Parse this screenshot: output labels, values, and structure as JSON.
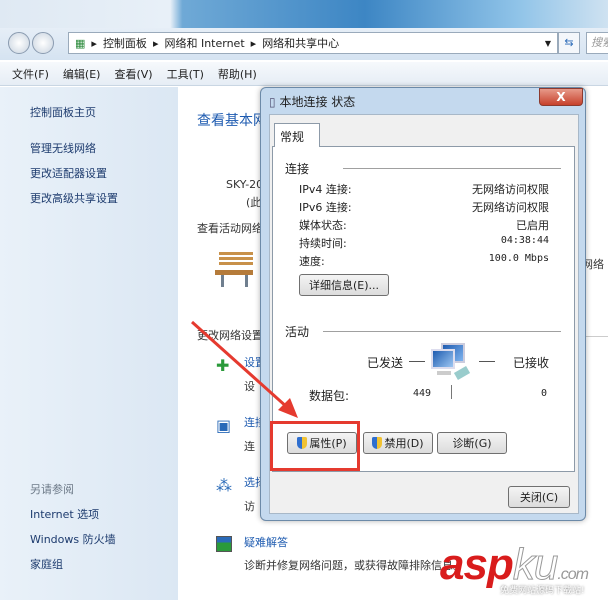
{
  "address": {
    "crumbs": [
      "控制面板",
      "网络和 Internet",
      "网络和共享中心"
    ],
    "search_placeholder": "搜索"
  },
  "menu": [
    "文件(F)",
    "编辑(E)",
    "查看(V)",
    "工具(T)",
    "帮助(H)"
  ],
  "left": {
    "links": [
      "控制面板主页",
      "管理无线网络",
      "更改适配器设置",
      "更改高级共享设置"
    ],
    "see_also": "另请参阅",
    "see_links": [
      "Internet 选项",
      "Windows 防火墙",
      "家庭组"
    ]
  },
  "main": {
    "title": "查看基本网",
    "computer": "SKY-20",
    "computer_sub": "(此",
    "active": "查看活动网络",
    "network_right": "网络",
    "change": "更改网络设置",
    "items": [
      {
        "link": "设置",
        "desc": "设"
      },
      {
        "link": "连接",
        "desc": "连"
      },
      {
        "link": "选择",
        "desc": "访"
      }
    ],
    "troubleshoot": "疑难解答",
    "troubleshoot_desc": "诊断并修复网络问题，或获得故障排除信息。"
  },
  "dialog": {
    "title": "本地连接 状态",
    "close_x": "X",
    "tab": "常规",
    "connection": "连接",
    "rows": [
      {
        "label": "IPv4 连接:",
        "value": "无网络访问权限"
      },
      {
        "label": "IPv6 连接:",
        "value": "无网络访问权限"
      },
      {
        "label": "媒体状态:",
        "value": "已启用"
      },
      {
        "label": "持续时间:",
        "value": "04:38:44"
      },
      {
        "label": "速度:",
        "value": "100.0 Mbps"
      }
    ],
    "details": "详细信息(E)...",
    "activity": "活动",
    "sent": "已发送",
    "received": "已接收",
    "packets": "数据包:",
    "packets_sent": "449",
    "packets_received": "0",
    "properties": "属性(P)",
    "disable": "禁用(D)",
    "diagnose": "诊断(G)",
    "close": "关闭(C)"
  },
  "watermark": {
    "brand": "aspku.com",
    "tagline": "免费网站源码下载站!"
  }
}
